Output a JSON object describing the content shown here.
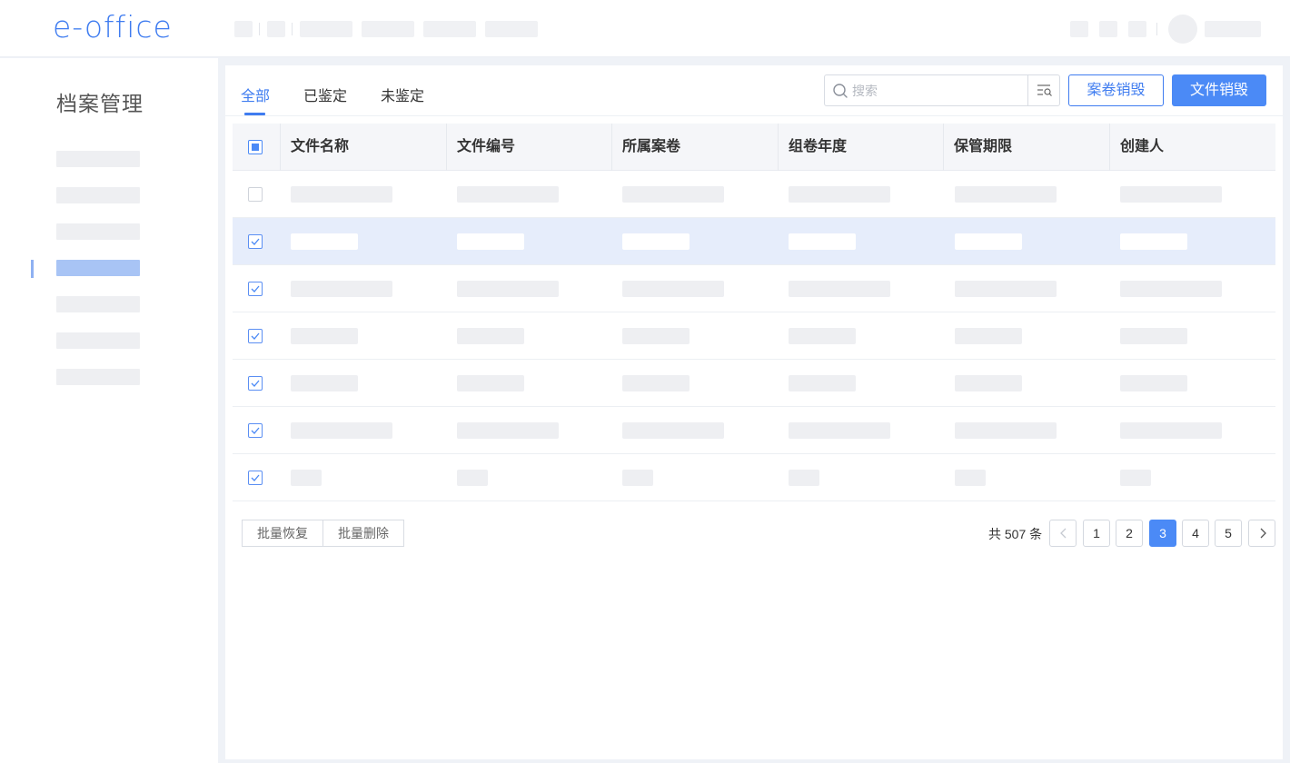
{
  "app": {
    "logo": "e-office"
  },
  "sidebar": {
    "title": "档案管理"
  },
  "tabs": [
    {
      "label": "全部",
      "active": true
    },
    {
      "label": "已鉴定",
      "active": false
    },
    {
      "label": "未鉴定",
      "active": false
    }
  ],
  "toolbar": {
    "search_placeholder": "搜索",
    "destroy_volume_label": "案卷销毁",
    "destroy_file_label": "文件销毁"
  },
  "table": {
    "columns": [
      "文件名称",
      "文件编号",
      "所属案卷",
      "组卷年度",
      "保管期限",
      "创建人"
    ],
    "rows": [
      {
        "checked": false,
        "selected": false
      },
      {
        "checked": true,
        "selected": true
      },
      {
        "checked": true,
        "selected": false
      },
      {
        "checked": true,
        "selected": false
      },
      {
        "checked": true,
        "selected": false
      },
      {
        "checked": true,
        "selected": false
      },
      {
        "checked": true,
        "selected": false
      }
    ]
  },
  "footer": {
    "batch_restore": "批量恢复",
    "batch_delete": "批量删除",
    "total_text": "共 507 条",
    "pages": [
      "1",
      "2",
      "3",
      "4",
      "5"
    ],
    "current_page": "3"
  },
  "colors": {
    "accent": "#3f7cf0",
    "primary_button": "#4b8af6",
    "selected_row": "#e6edfb"
  }
}
